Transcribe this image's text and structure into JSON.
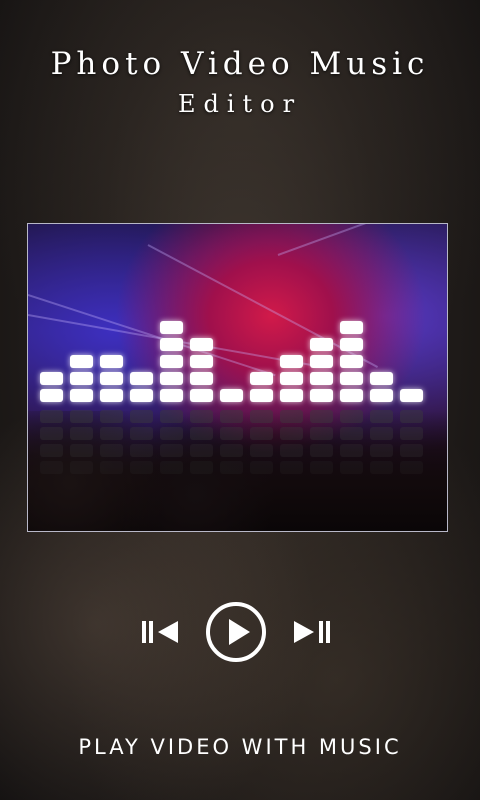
{
  "header": {
    "title_line1": "Photo Video Music",
    "title_line2": "Editor"
  },
  "preview": {
    "equalizer_levels": [
      2,
      3,
      3,
      2,
      5,
      4,
      1,
      2,
      3,
      4,
      5,
      2,
      1
    ],
    "equalizer_rows": 7,
    "lit_color": "#ffffff",
    "dim_color": "#3c3c3c"
  },
  "controls": {
    "previous_icon": "skip-previous-icon",
    "play_icon": "play-circle-icon",
    "next_icon": "skip-next-icon"
  },
  "footer": {
    "label": "PLAY VIDEO WITH MUSIC"
  }
}
